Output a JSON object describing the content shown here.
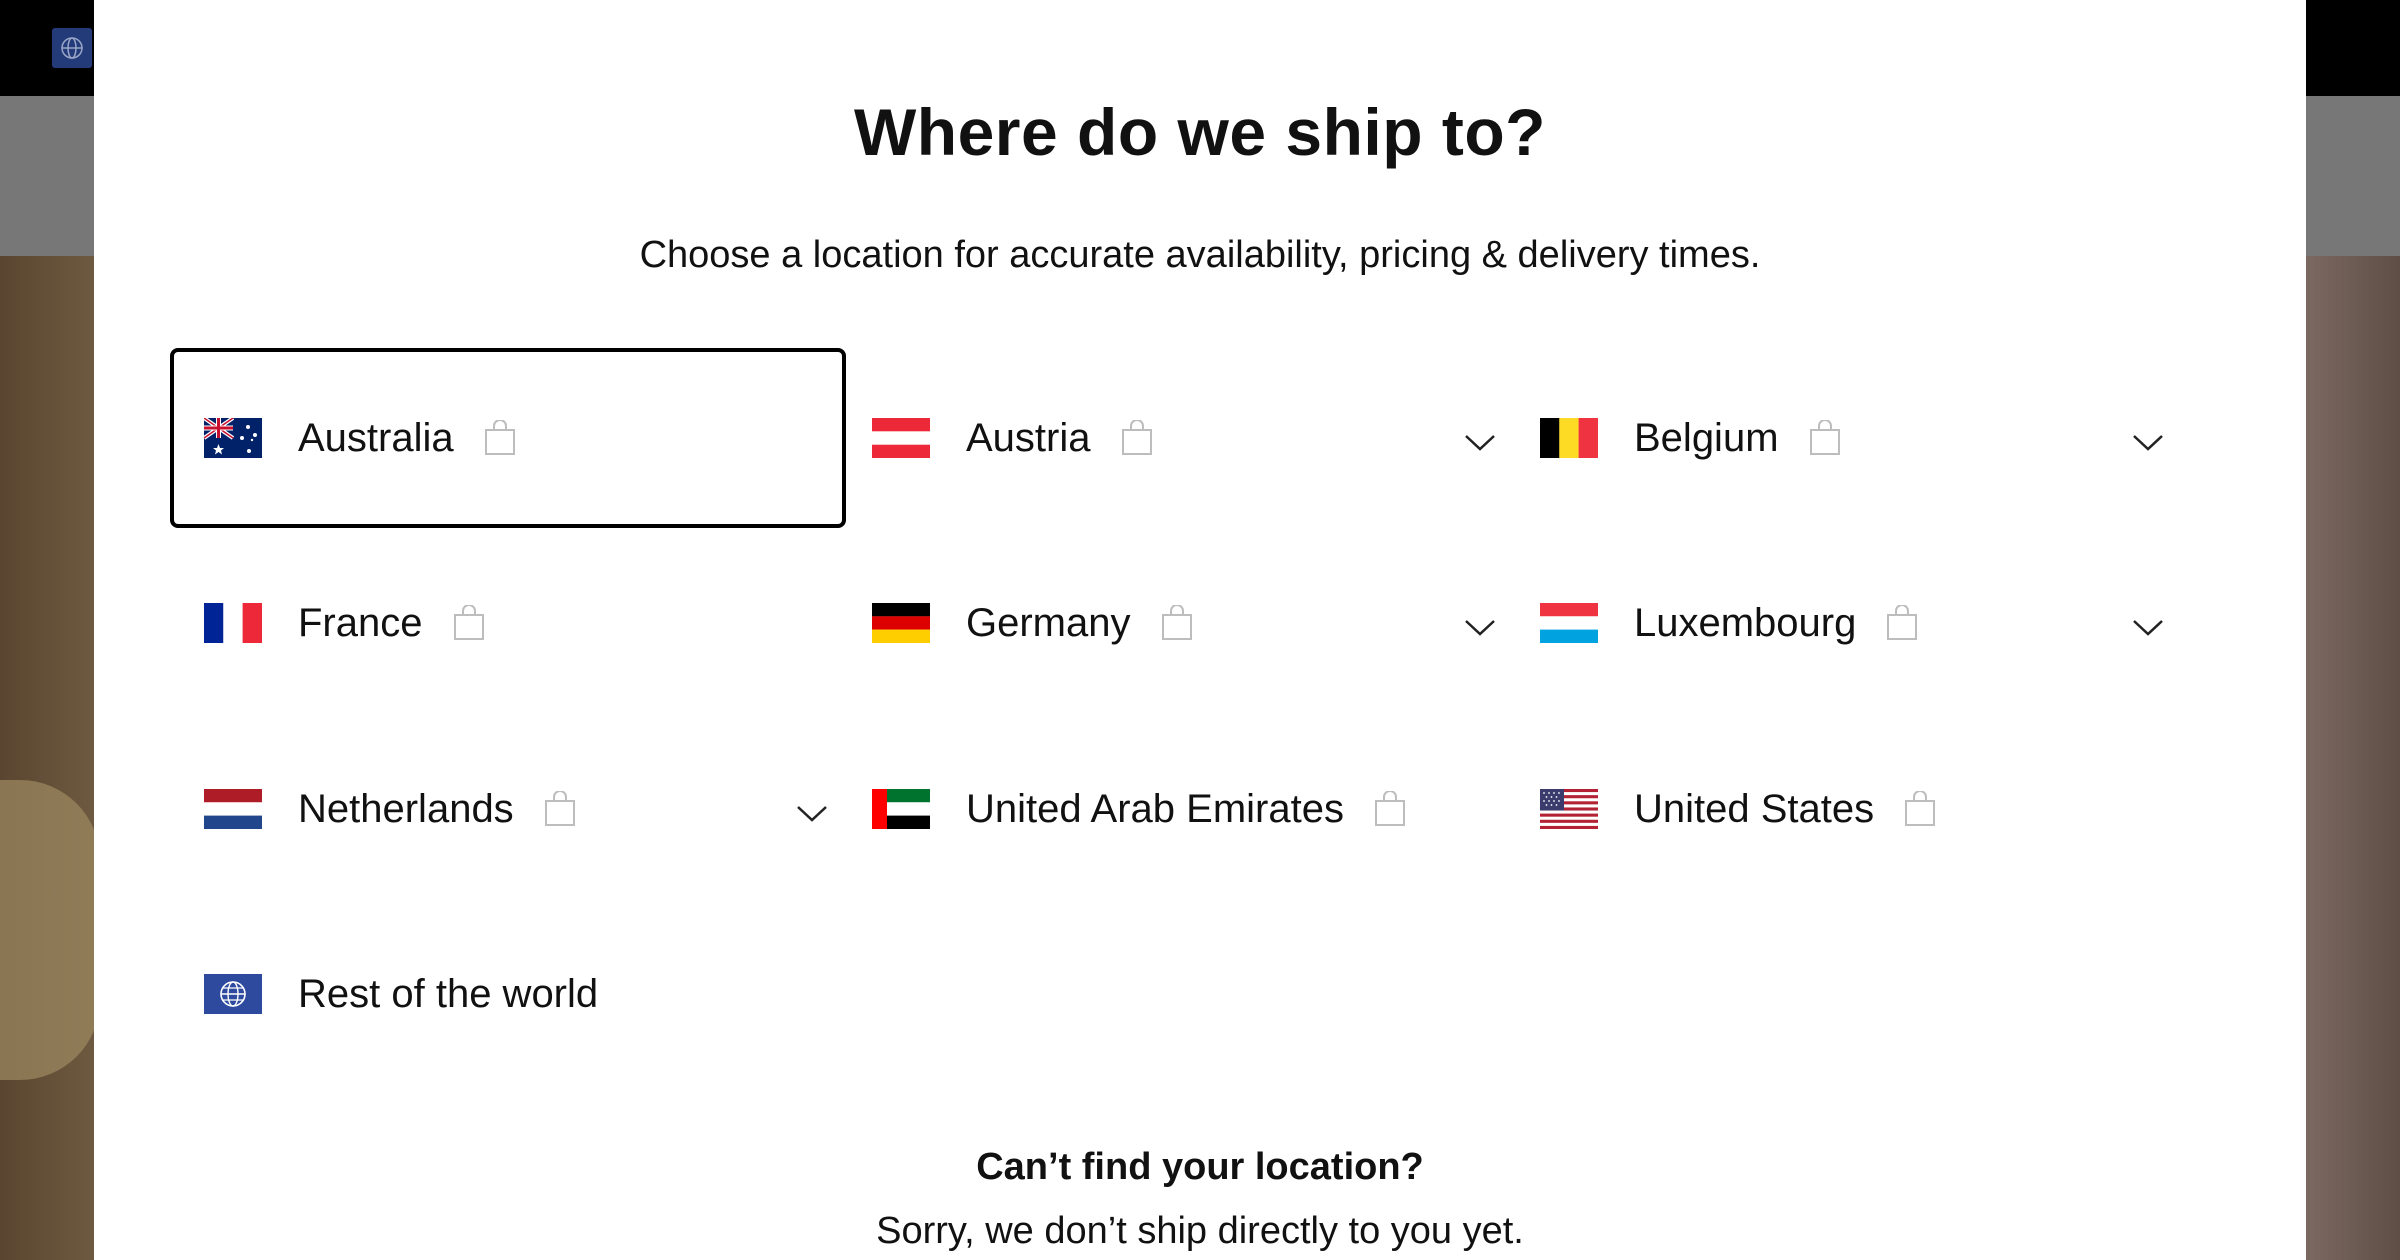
{
  "modal": {
    "title": "Where do we ship to?",
    "subtitle": "Choose a location for accurate availability, pricing & delivery times."
  },
  "locations": [
    {
      "name": "Australia",
      "flag": "australia-flag",
      "has_dropdown": false,
      "selected": true
    },
    {
      "name": "Austria",
      "flag": "austria-flag",
      "has_dropdown": true,
      "selected": false
    },
    {
      "name": "Belgium",
      "flag": "belgium-flag",
      "has_dropdown": true,
      "selected": false
    },
    {
      "name": "France",
      "flag": "france-flag",
      "has_dropdown": false,
      "selected": false
    },
    {
      "name": "Germany",
      "flag": "germany-flag",
      "has_dropdown": true,
      "selected": false
    },
    {
      "name": "Luxembourg",
      "flag": "luxembourg-flag",
      "has_dropdown": true,
      "selected": false
    },
    {
      "name": "Netherlands",
      "flag": "netherlands-flag",
      "has_dropdown": true,
      "selected": false
    },
    {
      "name": "United Arab Emirates",
      "flag": "uae-flag",
      "has_dropdown": false,
      "selected": false
    },
    {
      "name": "United States",
      "flag": "usa-flag",
      "has_dropdown": false,
      "selected": false
    },
    {
      "name": "Rest of the world",
      "flag": "globe-flag",
      "has_dropdown": false,
      "selected": false
    }
  ],
  "footer": {
    "heading": "Can’t find your location?",
    "text": "Sorry, we don’t ship directly to you yet."
  },
  "colors": {
    "selected_border": "#000000",
    "bag_icon": "#bdbdbd",
    "overlay_bar": "#000000"
  },
  "icons": {
    "bag": "shopping-bag-icon",
    "chevron": "chevron-down-icon",
    "globe": "globe-icon"
  }
}
